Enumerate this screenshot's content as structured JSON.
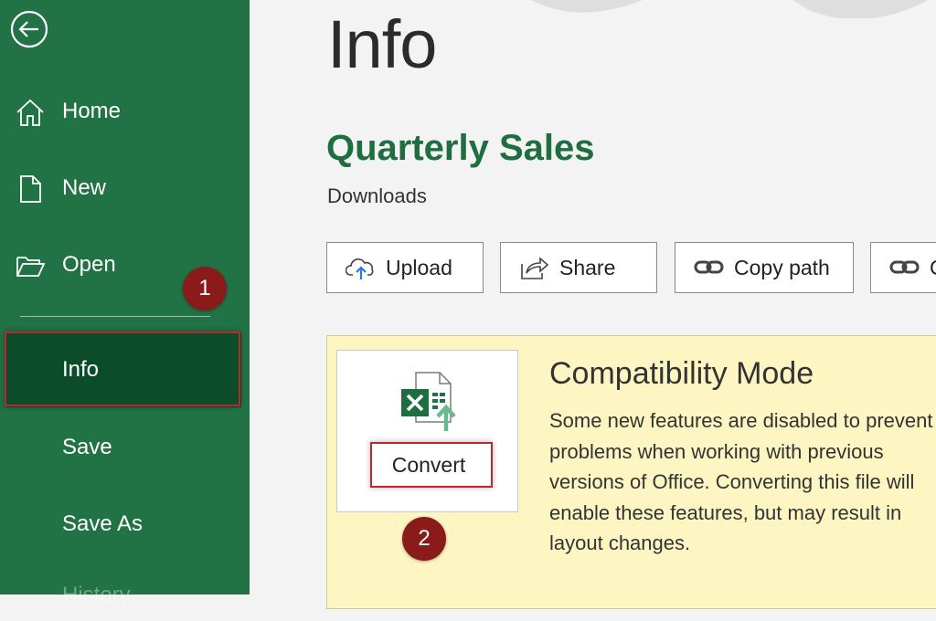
{
  "sidebar": {
    "items": [
      {
        "label": "Home"
      },
      {
        "label": "New"
      },
      {
        "label": "Open"
      },
      {
        "label": "Info"
      },
      {
        "label": "Save"
      },
      {
        "label": "Save As"
      },
      {
        "label": "History"
      }
    ],
    "selected": "Info"
  },
  "header": {
    "title": "Info"
  },
  "document": {
    "name": "Quarterly Sales",
    "location": "Downloads"
  },
  "actions": {
    "upload": "Upload",
    "share": "Share",
    "copy_path": "Copy path",
    "copy_link_partial": "C"
  },
  "compatibility": {
    "title": "Compatibility Mode",
    "convert_label": "Convert",
    "description": "Some new features are disabled to prevent problems when working with previous versions of Office. Converting this file will enable these features, but may result in layout changes."
  },
  "annotations": {
    "step1": "1",
    "step2": "2"
  },
  "colors": {
    "brand_green": "#217346",
    "selected_green": "#0b4d2b",
    "doc_title_green": "#1e6e40",
    "highlight_red": "#c0262b",
    "badge_red": "#8b1b1b",
    "panel_yellow": "#fdf6c3"
  },
  "icons": {
    "back": "back-arrow-icon",
    "home": "home-icon",
    "new": "new-document-icon",
    "open": "folder-open-icon",
    "upload": "cloud-upload-icon",
    "share": "share-icon",
    "copy": "link-icon",
    "convert": "excel-convert-icon"
  }
}
